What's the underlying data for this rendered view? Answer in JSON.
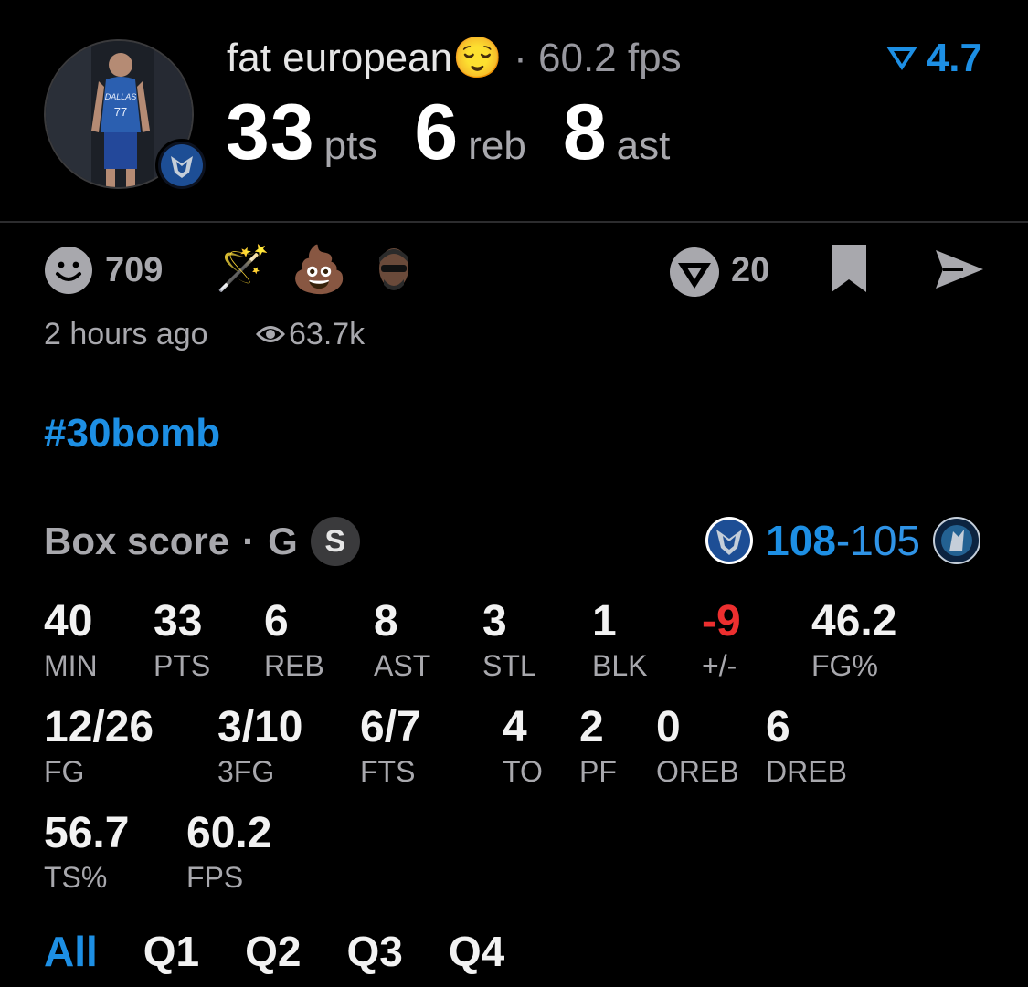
{
  "post": {
    "username": "fat european",
    "username_emoji": "😌",
    "separator": "·",
    "fps_text": "60.2 fps",
    "rating": "4.7",
    "statline": [
      {
        "num": "33",
        "unit": "pts"
      },
      {
        "num": "6",
        "unit": "reb"
      },
      {
        "num": "8",
        "unit": "ast"
      }
    ]
  },
  "reactions": {
    "count": "709",
    "emoji_wand": "🪄",
    "emoji_poop": "💩",
    "comment_count": "20",
    "time_ago": "2 hours ago",
    "views": "63.7k"
  },
  "hashtag": "#30bomb",
  "box_score": {
    "title": "Box score",
    "separator": "·",
    "position": "G",
    "badge": "S",
    "score_home": "108",
    "score_dash": "-",
    "score_away": "105",
    "row1": [
      {
        "value": "40",
        "label": "MIN"
      },
      {
        "value": "33",
        "label": "PTS"
      },
      {
        "value": "6",
        "label": "REB"
      },
      {
        "value": "8",
        "label": "AST"
      },
      {
        "value": "3",
        "label": "STL"
      },
      {
        "value": "1",
        "label": "BLK"
      },
      {
        "value": "-9",
        "label": "+/-"
      },
      {
        "value": "46.2",
        "label": "FG%"
      }
    ],
    "row2": [
      {
        "value": "12/26",
        "label": "FG"
      },
      {
        "value": "3/10",
        "label": "3FG"
      },
      {
        "value": "6/7",
        "label": "FTS"
      },
      {
        "value": "4",
        "label": "TO"
      },
      {
        "value": "2",
        "label": "PF"
      },
      {
        "value": "0",
        "label": "OREB"
      },
      {
        "value": "6",
        "label": "DREB"
      }
    ],
    "row3": [
      {
        "value": "56.7",
        "label": "TS%"
      },
      {
        "value": "60.2",
        "label": "FPS"
      }
    ]
  },
  "tabs": [
    "All",
    "Q1",
    "Q2",
    "Q3",
    "Q4"
  ],
  "colors": {
    "accent": "#1d8fe4",
    "negative": "#ec2f2f",
    "muted": "#a8a8ad",
    "background": "#000000"
  },
  "icons": [
    "smiley-icon",
    "magic-wand-icon",
    "poop-emoji-icon",
    "user-avatar-icon",
    "comment-logo-icon",
    "bookmark-icon",
    "send-icon",
    "eye-icon",
    "rating-logo-icon",
    "mavericks-logo-icon",
    "timberwolves-logo-icon"
  ]
}
